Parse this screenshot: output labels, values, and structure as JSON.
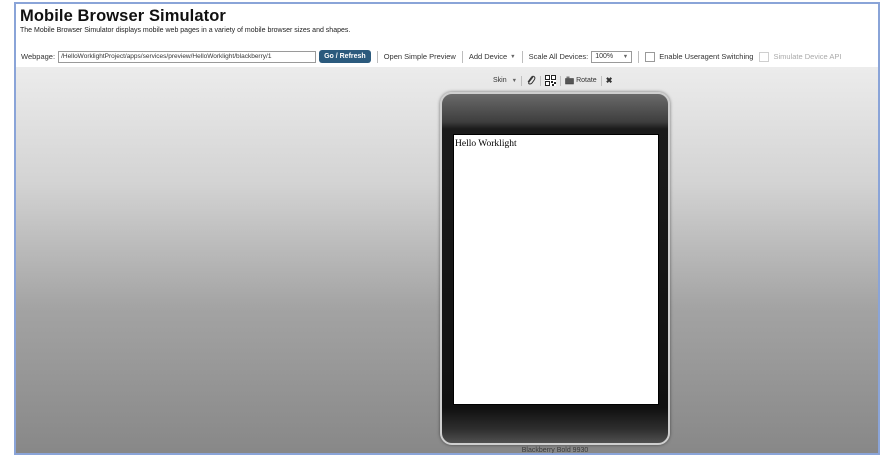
{
  "header": {
    "title": "Mobile Browser Simulator",
    "description": "The Mobile Browser Simulator displays mobile web pages in a variety of mobile browser sizes and shapes."
  },
  "toolbar": {
    "webpage_label": "Webpage:",
    "url_value": "/HelloWorklightProject/apps/services/preview/HelloWorklight/blackberry/1",
    "go_label": "Go / Refresh",
    "open_simple_preview": "Open Simple Preview",
    "add_device": "Add Device",
    "scale_label": "Scale All Devices:",
    "scale_value": "100%",
    "useragent_label": "Enable Useragent Switching",
    "useragent_checked": false,
    "simulate_api_label": "Simulate Device API",
    "simulate_api_checked": false
  },
  "device_toolbar": {
    "skin_label": "Skin",
    "rotate_label": "Rotate",
    "icons": [
      "paperclip-icon",
      "qr-code-icon",
      "rotate-icon",
      "close-icon"
    ]
  },
  "device": {
    "screen_text": "Hello Worklight",
    "name": "Blackberry Bold 9930"
  },
  "colors": {
    "frame_border": "#8aa4d8",
    "go_button": "#2b5a7d"
  }
}
